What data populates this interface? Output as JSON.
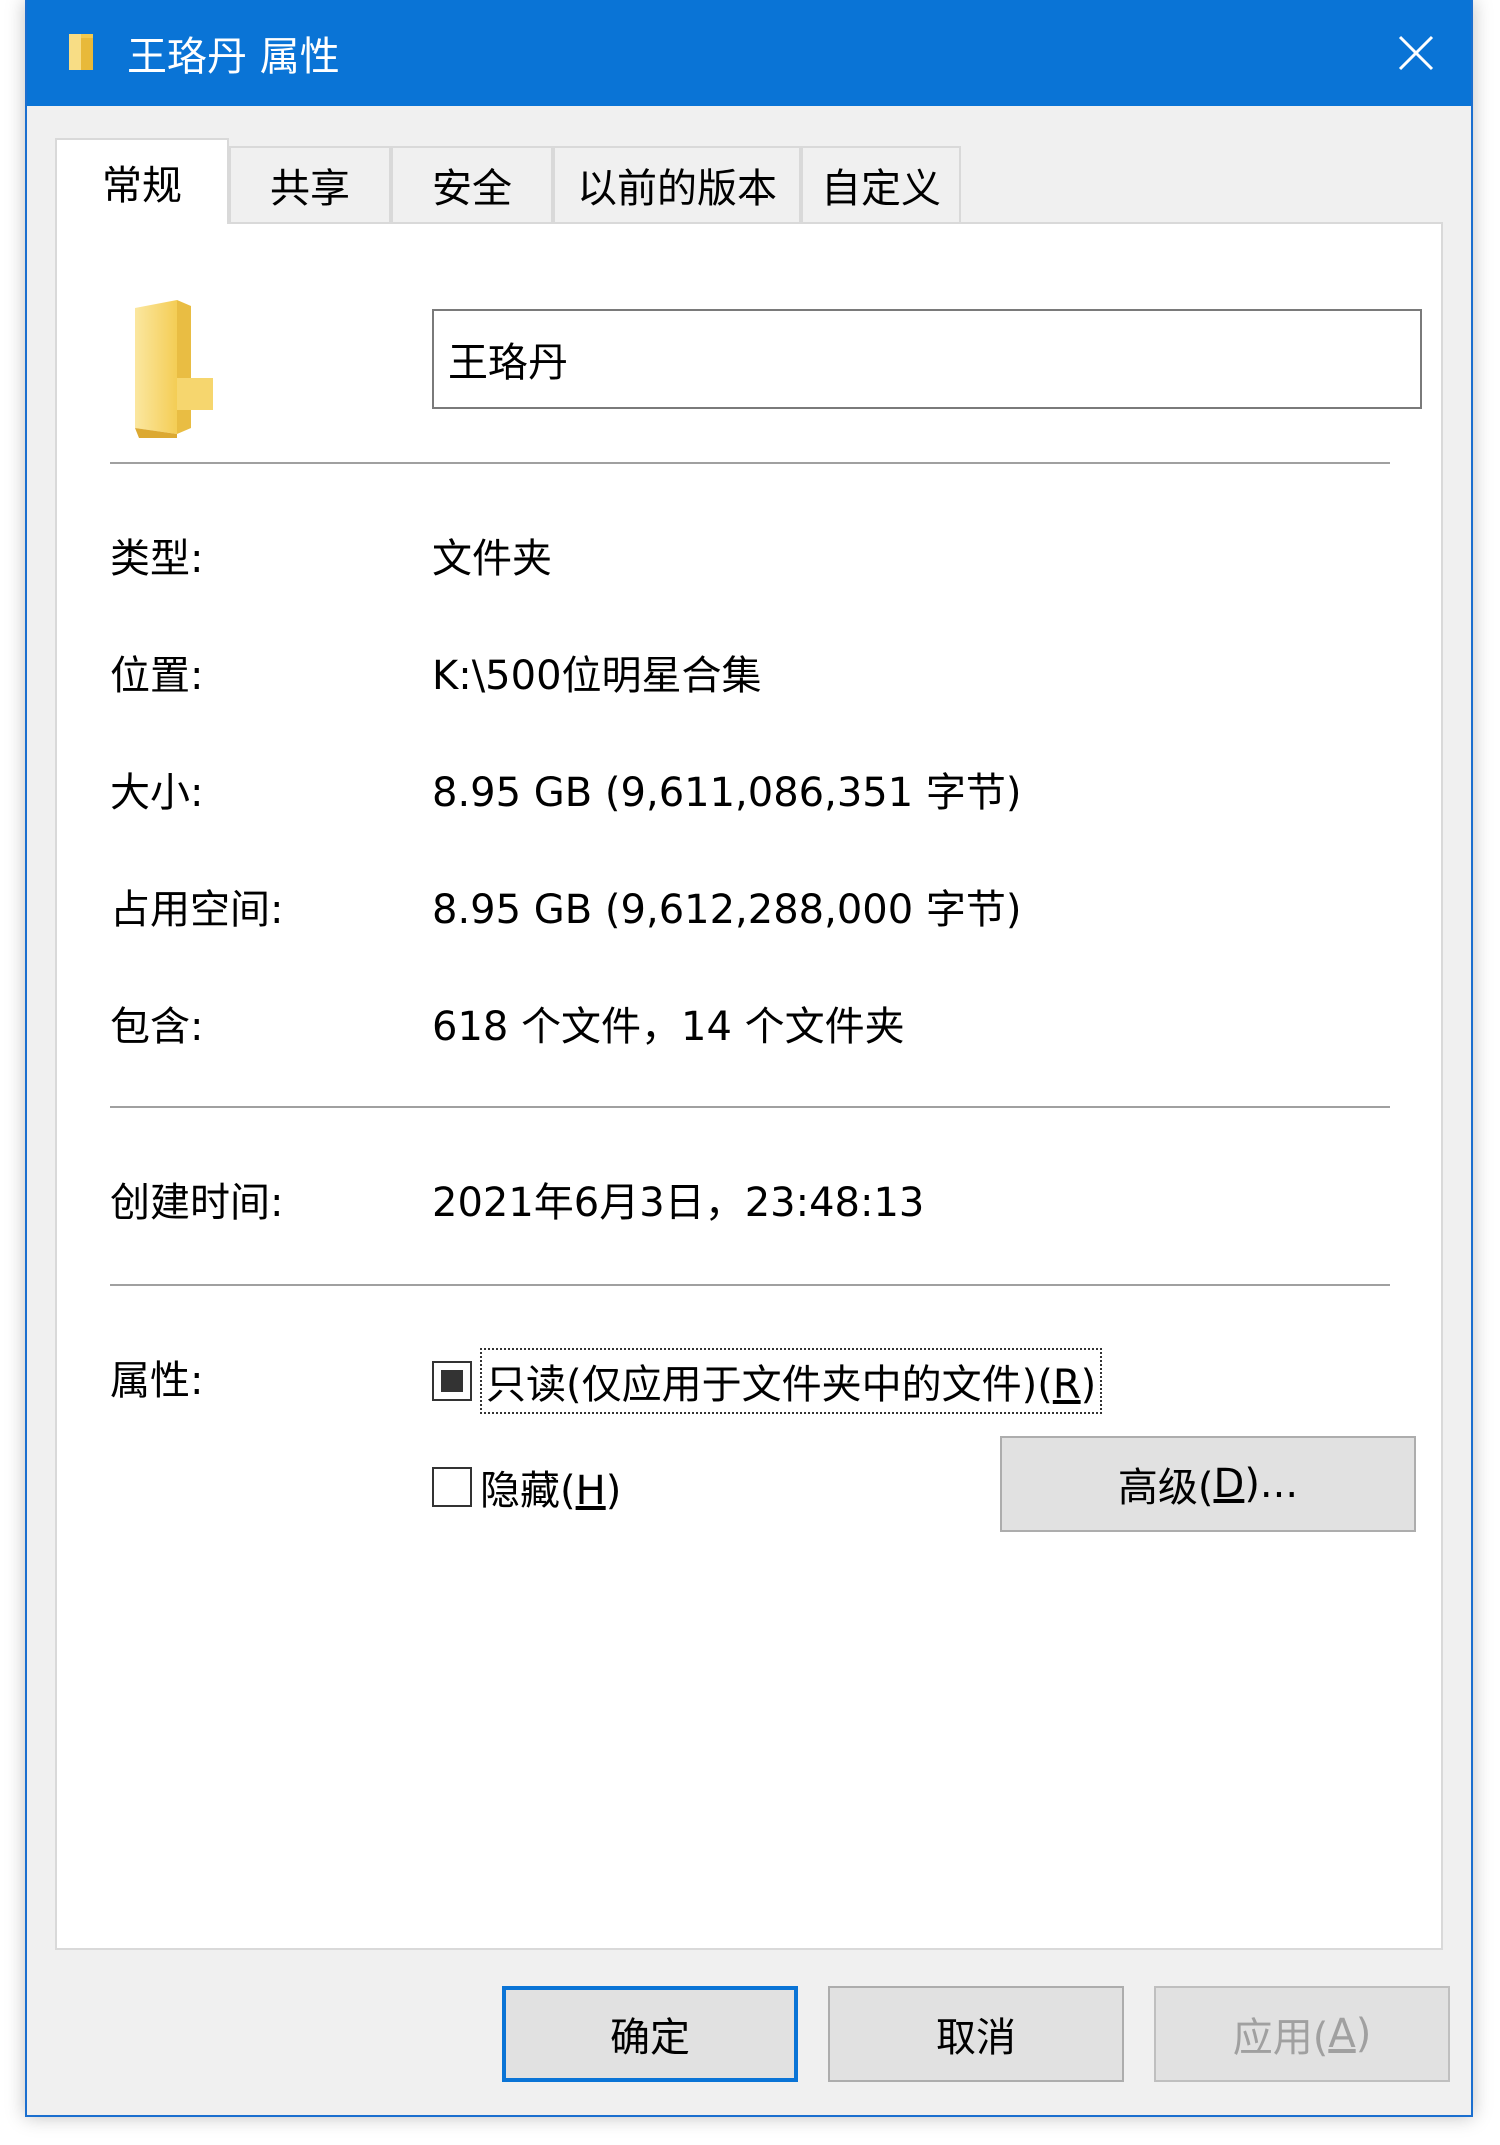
{
  "window": {
    "title": "王珞丹 属性"
  },
  "tabs": [
    {
      "label": "常规"
    },
    {
      "label": "共享"
    },
    {
      "label": "安全"
    },
    {
      "label": "以前的版本"
    },
    {
      "label": "自定义"
    }
  ],
  "general": {
    "name_value": "王珞丹",
    "type_label": "类型:",
    "type_value": "文件夹",
    "location_label": "位置:",
    "location_value": "K:\\500位明星合集",
    "size_label": "大小:",
    "size_value": "8.95 GB (9,611,086,351 字节)",
    "disk_size_label": "占用空间:",
    "disk_size_value": "8.95 GB (9,612,288,000 字节)",
    "contains_label": "包含:",
    "contains_value": "618 个文件，14 个文件夹",
    "created_label": "创建时间:",
    "created_value": "2021年6月3日，23:48:13",
    "attributes_label": "属性:",
    "readonly": {
      "label_pre": "只读(仅应用于文件夹中的文件)(",
      "accel": "R",
      "label_post": ")",
      "state": "indeterminate"
    },
    "hidden": {
      "label_pre": "隐藏(",
      "accel": "H",
      "label_post": ")",
      "state": "unchecked"
    },
    "advanced": {
      "label_pre": "高级(",
      "accel": "D",
      "label_post": ")..."
    }
  },
  "footer": {
    "ok_label": "确定",
    "cancel_label": "取消",
    "apply_pre": "应用(",
    "apply_accel": "A",
    "apply_post": ")"
  },
  "colors": {
    "titlebar": "#0a74d6",
    "folder_yellow": "#f3d36e",
    "default_button_border": "#0a74d6"
  },
  "icons": {
    "title": "folder-icon",
    "close": "close-icon",
    "main": "folder-icon"
  }
}
